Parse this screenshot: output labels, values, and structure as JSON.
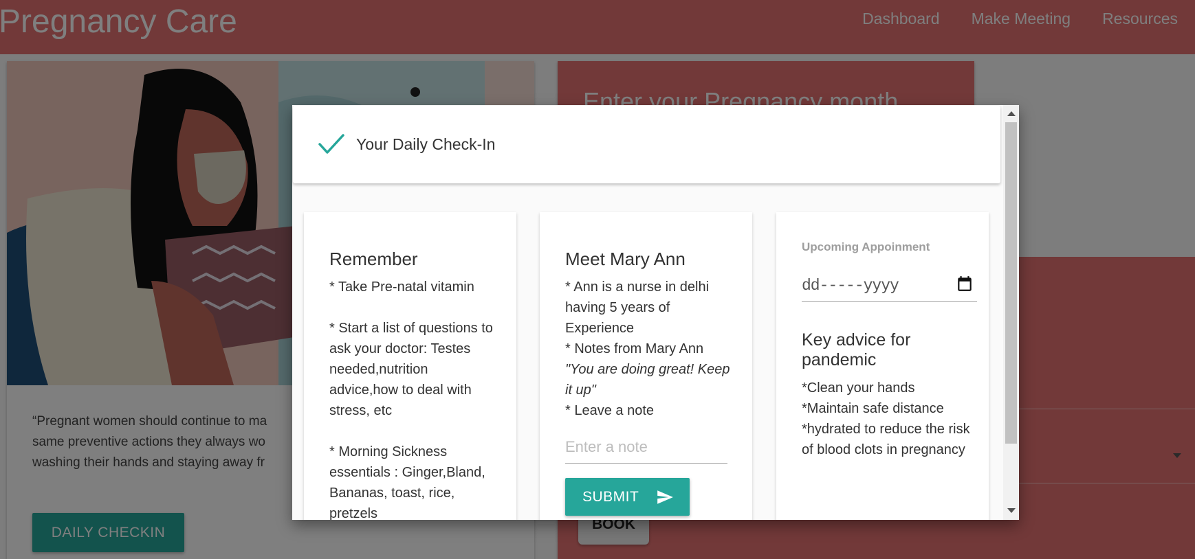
{
  "navbar": {
    "brand": "Pregnancy Care",
    "links": [
      "Dashboard",
      "Make Meeting",
      "Resources"
    ]
  },
  "background": {
    "quote": "“Pregnant women should continue to ma... same preventive actions they always wo... washing their hands and staying away fr...",
    "quote_lines": [
      "“Pregnant women should continue to ma",
      "same preventive actions they always wo",
      "washing their hands and staying away fr"
    ],
    "daily_checkin_label": "DAILY CHECKIN",
    "form_title": "Enter your Pregnancy month",
    "book_label": "BOOK"
  },
  "modal": {
    "title": "Your Daily Check-In",
    "remember": {
      "title": "Remember",
      "lines": [
        "* Take Pre-natal vitamin",
        "",
        "* Start a list of questions to ask your doctor: Testes needed,nutrition advice,how to deal with stress, etc",
        "",
        "* Morning Sickness essentials : Ginger,Bland, Bananas, toast, rice, pretzels"
      ]
    },
    "mary_ann": {
      "title": "Meet Mary Ann",
      "line1": "* Ann is a nurse in delhi having 5 years of Experience",
      "line2": "* Notes from Mary Ann",
      "quote": "\"You are doing great! Keep it up\"",
      "line3": "* Leave a note",
      "note_placeholder": "Enter a note",
      "note_value": "",
      "submit_label": "SUBMIT"
    },
    "appointment": {
      "label": "Upcoming Appoinment",
      "date_placeholder": "dd-----yyyy",
      "advice_title": "Key advice for pandemic",
      "advice_lines": [
        "*Clean your hands",
        "*Maintain safe distance",
        "*hydrated to reduce the risk of blood clots in pregnancy"
      ]
    }
  },
  "colors": {
    "brand": "#e57373",
    "accent": "#26a69a"
  },
  "icons": {
    "check": "check-icon",
    "send": "send-icon",
    "calendar": "calendar-icon"
  }
}
